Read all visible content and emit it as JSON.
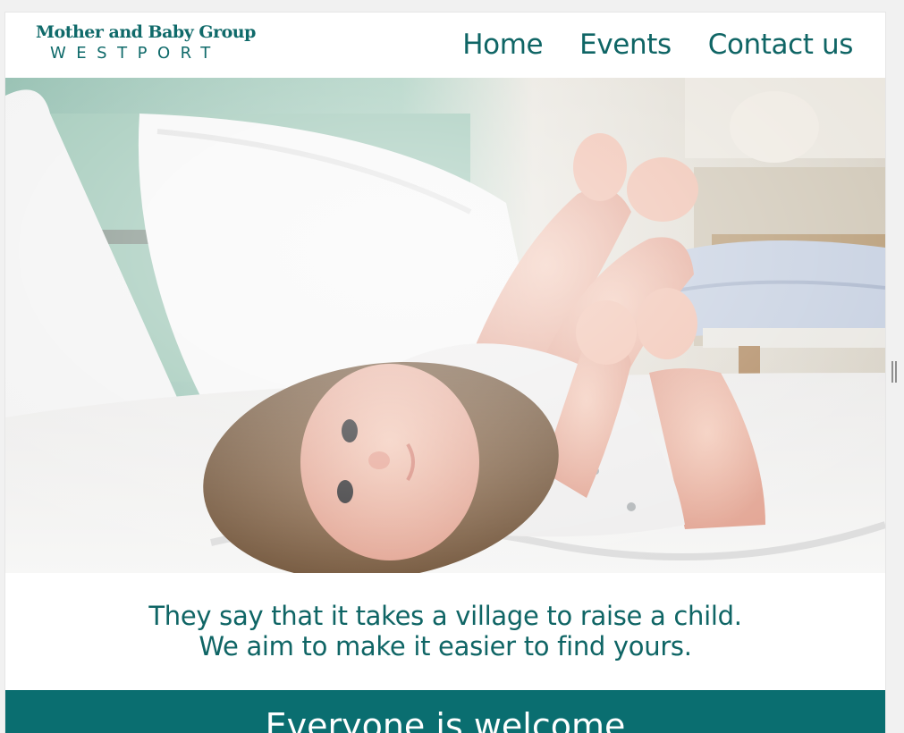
{
  "header": {
    "logo_title": "Mother and Baby Group",
    "logo_subtitle": "WESTPORT"
  },
  "nav": {
    "items": [
      {
        "label": "Home"
      },
      {
        "label": "Events"
      },
      {
        "label": "Contact us"
      }
    ]
  },
  "hero": {
    "alt": "Baby lying on a bed holding its feet"
  },
  "tagline": {
    "line1": "They say that it takes a village to raise a child.",
    "line2": "We aim to make it easier to find yours."
  },
  "banner": {
    "title": "Everyone is welcome"
  },
  "colors": {
    "brand_teal": "#0f6565",
    "banner_teal": "#0a6e70",
    "background": "#ffffff"
  }
}
